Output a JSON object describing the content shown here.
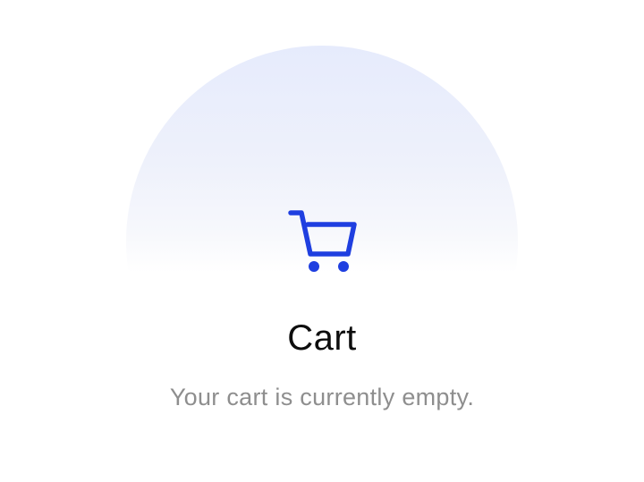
{
  "empty_state": {
    "icon": "cart-icon",
    "title": "Cart",
    "message": "Your cart is currently empty."
  },
  "colors": {
    "accent": "#1f3fe0",
    "circle_top": "#e6ebfc",
    "title_text": "#0d0d0d",
    "message_text": "#8e8e8e",
    "background": "#ffffff"
  }
}
